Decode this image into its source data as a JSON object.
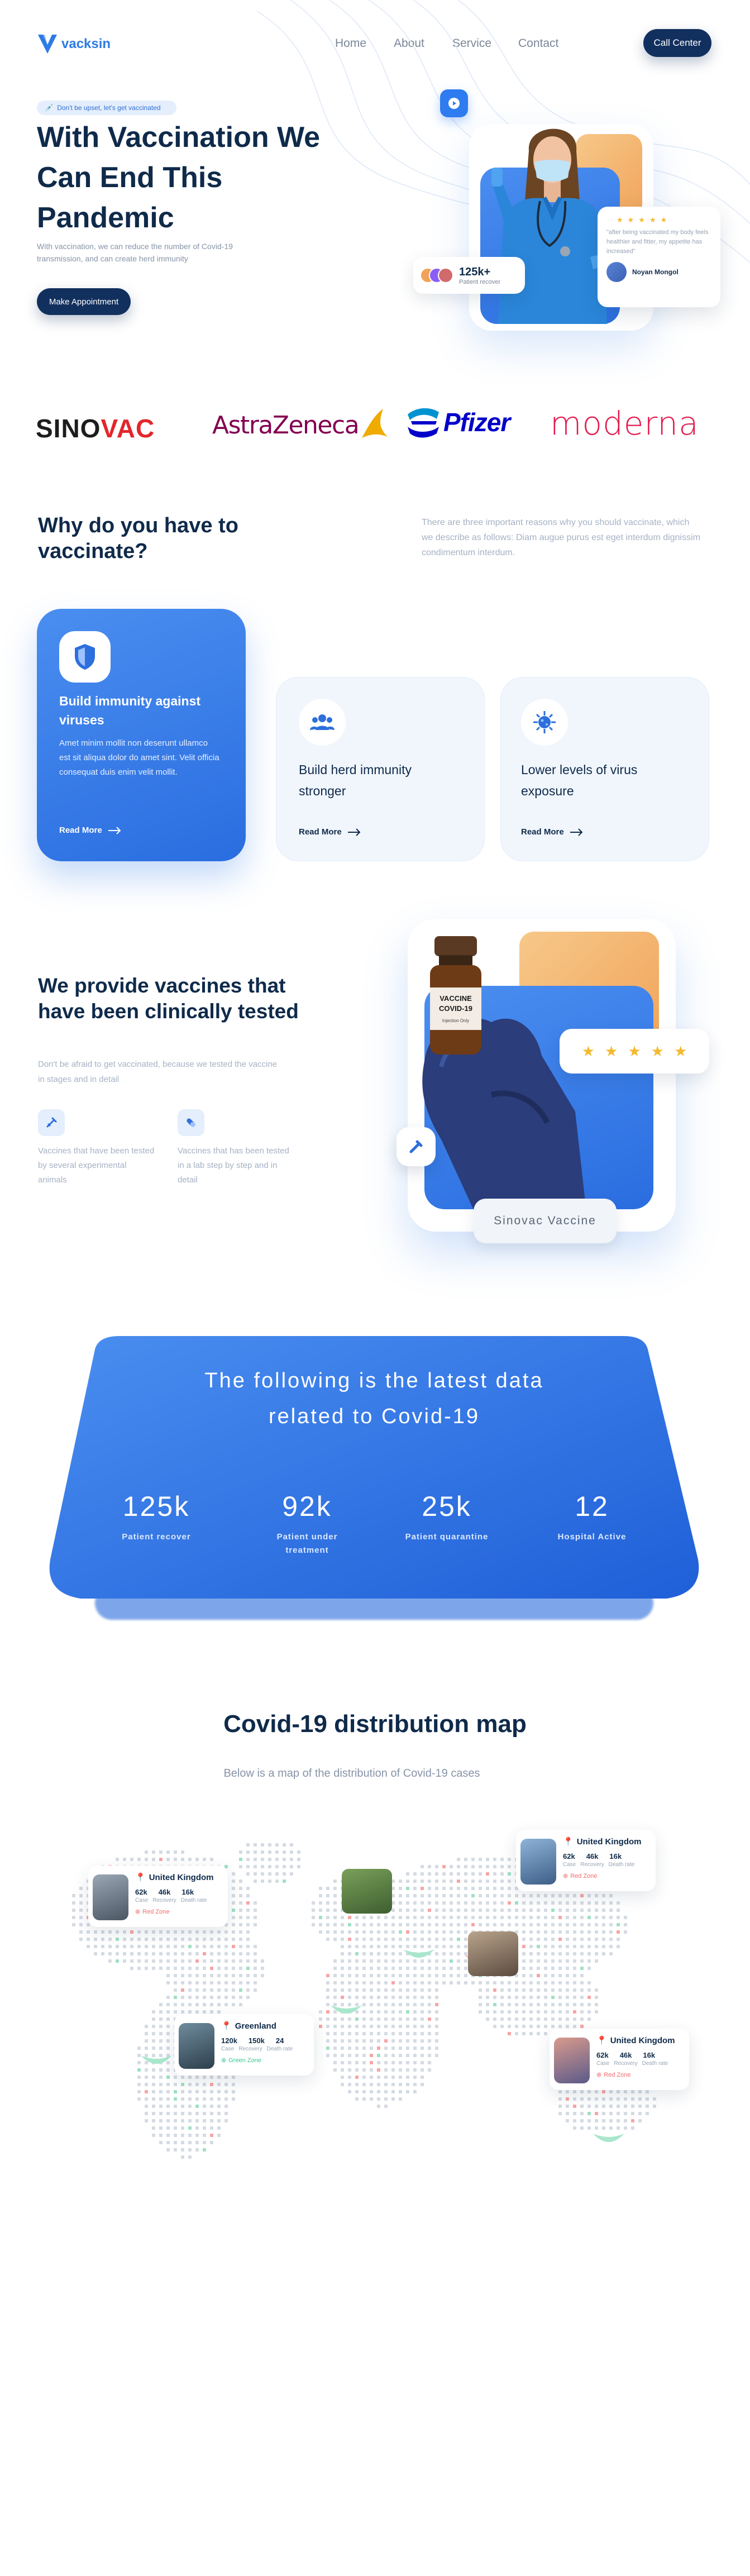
{
  "brand": {
    "name": "vacksin"
  },
  "nav": {
    "items": [
      "Home",
      "About",
      "Service",
      "Contact"
    ],
    "cta": "Call Center"
  },
  "hero": {
    "pill": "Don't be upset, let's get vaccinated",
    "title": "With Vaccination We Can End This Pandemic",
    "subtitle": "With vaccination, we can reduce the number of Covid-19 transmission, and can create herd immunity",
    "button": "Make Appointment",
    "stat_value": "125k+",
    "stat_label": "Patient recover",
    "review_text": "\"after being vaccinated my body feels healthier and fitter, my appetite has increased\"",
    "reviewer": "Noyan Mongol",
    "rating": 5
  },
  "brands": [
    "SINOVAC",
    "AstraZeneca",
    "Pfizer",
    "moderna"
  ],
  "why": {
    "title": "Why do you have to vaccinate?",
    "description": "There are three important reasons why you should vaccinate, which we describe as follows: Diam augue purus est eget interdum dignissim condimentum interdum.",
    "cards": [
      {
        "title": "Build immunity against viruses",
        "body": "Amet minim mollit non deserunt ullamco est sit aliqua dolor do amet sint. Velit officia consequat duis enim velit mollit.",
        "link": "Read More"
      },
      {
        "title": "Build herd immunity stronger",
        "link": "Read More"
      },
      {
        "title": "Lower levels of virus exposure",
        "link": "Read More"
      }
    ]
  },
  "vaccines": {
    "title": "We provide vaccines that have been clinically tested",
    "subtitle": "Don't be afraid to get vaccinated, because we tested the vaccine in stages and in detail",
    "features": [
      "Vaccines that have been tested by several experimental animals",
      "Vaccines that has been tested in a lab step by step and in detail"
    ],
    "vial_label": "VACCINE COVID-19",
    "vial_sub": "Injection Only",
    "rating": 5,
    "name_tag": "Sinovac Vaccine"
  },
  "stats": {
    "title": "The following is the latest data related to Covid-19",
    "items": [
      {
        "value": "125k",
        "label": "Patient recover"
      },
      {
        "value": "92k",
        "label": "Patient under treatment"
      },
      {
        "value": "25k",
        "label": "Patient quarantine"
      },
      {
        "value": "12",
        "label": "Hospital Active"
      }
    ]
  },
  "map": {
    "title": "Covid-19 distribution map",
    "subtitle": "Below is a map of the distribution of Covid-19 cases",
    "value_labels": [
      "Case",
      "Recovery",
      "Death rate"
    ],
    "locations": [
      {
        "name": "United Kingdom",
        "values": [
          "62k",
          "46k",
          "16k"
        ],
        "zone": "Red Zone"
      },
      {
        "name": "United Kingdom",
        "values": [
          "62k",
          "46k",
          "16k"
        ],
        "zone": "Red Zone"
      },
      {
        "name": "Greenland",
        "values": [
          "120k",
          "150k",
          "24"
        ],
        "zone": "Green Zone"
      },
      {
        "name": "United Kingdom",
        "values": [
          "62k",
          "46k",
          "16k"
        ],
        "zone": "Red Zone"
      }
    ]
  },
  "colors": {
    "primary": "#2d7be5",
    "dark": "#12305e",
    "accent_orange": "#f3a55b",
    "star": "#f5b82e",
    "red_zone": "#f46a6a",
    "green_zone": "#3cc792"
  }
}
